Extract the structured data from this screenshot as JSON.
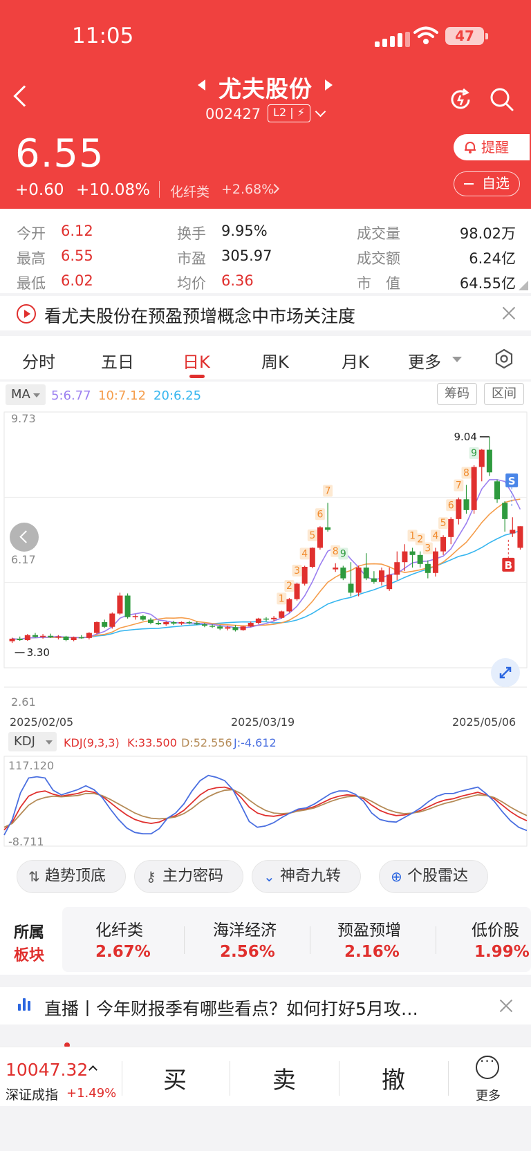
{
  "status_bar": {
    "time": "11:05",
    "battery": "47"
  },
  "header": {
    "stock_name": "尤夫股份",
    "stock_code": "002427",
    "level_badge": "L2 | ⚡"
  },
  "quote": {
    "price": "6.55",
    "change": "+0.60",
    "change_pct": "+10.08%",
    "sector": "化纤类",
    "sector_pct": "+2.68%",
    "remind_label": "提醒",
    "watch_label": "自选"
  },
  "stats": [
    {
      "label": "今开",
      "value": "6.12"
    },
    {
      "label": "最高",
      "value": "6.55"
    },
    {
      "label": "最低",
      "value": "6.02"
    },
    {
      "label": "换手",
      "value": "9.95%"
    },
    {
      "label": "市盈",
      "value": "305.97"
    },
    {
      "label": "均价",
      "value": "6.36"
    },
    {
      "label": "成交量",
      "value": "98.02万"
    },
    {
      "label": "成交额",
      "value": "6.24亿"
    },
    {
      "label": "市　值",
      "value": "64.55亿"
    }
  ],
  "notice": {
    "text": "看尤夫股份在预盈预增概念中市场关注度"
  },
  "tabs": [
    "分时",
    "五日",
    "日K",
    "周K",
    "月K",
    "更多"
  ],
  "active_tab": "日K",
  "chart_controls": {
    "ma_selector": "MA",
    "ma5": "5:6.77",
    "ma10": "10:7.12",
    "ma20": "20:6.25",
    "chip_button": "筹码",
    "range_button": "区间"
  },
  "colors": {
    "up": "#e0302e",
    "down": "#2e9a3e",
    "ma5": "#9b7ff0",
    "ma10": "#f59d4b",
    "ma20": "#37b6ef",
    "brand": "#f0413f"
  },
  "chart_data": [
    {
      "type": "candlestick",
      "y_axis_labels": [
        "9.73",
        "6.17",
        "2.61"
      ],
      "ylim": [
        2.61,
        9.73
      ],
      "x_labels": [
        "2025/02/05",
        "2025/03/19",
        "2025/05/06"
      ],
      "max_marker": "9.04",
      "min_marker": "3.30",
      "candles": [
        [
          3.35,
          3.45,
          3.3,
          3.42
        ],
        [
          3.42,
          3.48,
          3.36,
          3.38
        ],
        [
          3.38,
          3.55,
          3.36,
          3.52
        ],
        [
          3.52,
          3.58,
          3.45,
          3.47
        ],
        [
          3.47,
          3.55,
          3.42,
          3.5
        ],
        [
          3.5,
          3.56,
          3.44,
          3.46
        ],
        [
          3.46,
          3.52,
          3.4,
          3.48
        ],
        [
          3.48,
          3.5,
          3.35,
          3.38
        ],
        [
          3.38,
          3.48,
          3.35,
          3.46
        ],
        [
          3.46,
          3.52,
          3.42,
          3.44
        ],
        [
          3.44,
          3.6,
          3.4,
          3.58
        ],
        [
          3.58,
          3.9,
          3.55,
          3.88
        ],
        [
          3.88,
          3.95,
          3.72,
          3.75
        ],
        [
          3.75,
          4.15,
          3.7,
          4.12
        ],
        [
          4.12,
          4.7,
          4.08,
          4.62
        ],
        [
          4.62,
          4.68,
          3.98,
          4.02
        ],
        [
          4.02,
          4.1,
          3.95,
          4.05
        ],
        [
          4.05,
          4.08,
          3.92,
          3.95
        ],
        [
          3.95,
          4.0,
          3.82,
          3.86
        ],
        [
          3.86,
          3.92,
          3.8,
          3.82
        ],
        [
          3.82,
          3.9,
          3.78,
          3.88
        ],
        [
          3.88,
          3.92,
          3.8,
          3.84
        ],
        [
          3.84,
          3.9,
          3.8,
          3.88
        ],
        [
          3.88,
          3.92,
          3.82,
          3.85
        ],
        [
          3.85,
          3.9,
          3.8,
          3.82
        ],
        [
          3.82,
          3.86,
          3.74,
          3.78
        ],
        [
          3.78,
          3.82,
          3.72,
          3.76
        ],
        [
          3.76,
          3.8,
          3.66,
          3.7
        ],
        [
          3.7,
          3.78,
          3.65,
          3.74
        ],
        [
          3.74,
          3.8,
          3.62,
          3.66
        ],
        [
          3.66,
          3.78,
          3.64,
          3.76
        ],
        [
          3.76,
          3.9,
          3.74,
          3.86
        ],
        [
          3.86,
          4.0,
          3.82,
          3.98
        ],
        [
          3.98,
          4.02,
          3.9,
          3.96
        ],
        [
          3.96,
          4.05,
          3.9,
          4.0
        ],
        [
          4.0,
          4.2,
          3.98,
          4.18
        ],
        [
          4.18,
          4.55,
          4.15,
          4.52
        ],
        [
          4.52,
          4.98,
          4.48,
          4.95
        ],
        [
          4.95,
          5.45,
          4.9,
          5.42
        ],
        [
          5.42,
          5.96,
          5.38,
          5.95
        ],
        [
          5.95,
          6.55,
          5.9,
          6.52
        ],
        [
          6.52,
          7.2,
          6.4,
          6.45
        ],
        [
          5.35,
          5.52,
          5.28,
          5.4
        ],
        [
          5.4,
          5.45,
          5.05,
          5.1
        ],
        [
          4.95,
          5.55,
          4.6,
          4.7
        ],
        [
          4.7,
          5.45,
          4.6,
          5.4
        ],
        [
          5.4,
          5.8,
          5.05,
          5.1
        ],
        [
          5.1,
          5.3,
          4.95,
          5.0
        ],
        [
          5.0,
          5.4,
          4.9,
          5.32
        ],
        [
          4.8,
          5.4,
          4.75,
          5.2
        ],
        [
          5.2,
          5.85,
          5.05,
          5.55
        ],
        [
          5.55,
          6.05,
          5.3,
          5.85
        ],
        [
          5.85,
          5.95,
          5.4,
          5.75
        ],
        [
          5.75,
          5.85,
          5.4,
          5.5
        ],
        [
          5.5,
          5.6,
          5.1,
          5.25
        ],
        [
          5.25,
          5.95,
          5.15,
          5.85
        ],
        [
          5.85,
          6.3,
          5.75,
          6.25
        ],
        [
          6.25,
          6.8,
          6.05,
          6.75
        ],
        [
          6.75,
          7.35,
          6.6,
          7.3
        ],
        [
          7.3,
          7.7,
          6.9,
          7.0
        ],
        [
          7.0,
          8.25,
          6.9,
          8.2
        ],
        [
          8.2,
          8.7,
          7.8,
          8.68
        ],
        [
          8.68,
          9.04,
          7.95,
          8.05
        ],
        [
          7.8,
          7.85,
          7.2,
          7.3
        ],
        [
          7.2,
          7.25,
          6.4,
          6.75
        ],
        [
          6.35,
          6.8,
          6.25,
          6.45
        ],
        [
          5.95,
          6.55,
          5.9,
          6.55
        ]
      ],
      "signals": [
        {
          "label": "1",
          "candle": 35
        },
        {
          "label": "2",
          "candle": 36
        },
        {
          "label": "3",
          "candle": 37
        },
        {
          "label": "4",
          "candle": 38
        },
        {
          "label": "5",
          "candle": 39
        },
        {
          "label": "6",
          "candle": 40
        },
        {
          "label": "7",
          "candle": 41
        },
        {
          "label": "8",
          "candle": 42
        },
        {
          "label": "9",
          "candle": 43
        },
        {
          "label": "1",
          "candle": 52
        },
        {
          "label": "2",
          "candle": 53
        },
        {
          "label": "3",
          "candle": 54
        },
        {
          "label": "4",
          "candle": 55
        },
        {
          "label": "5",
          "candle": 56
        },
        {
          "label": "6",
          "candle": 57
        },
        {
          "label": "7",
          "candle": 58
        },
        {
          "label": "8",
          "candle": 59
        },
        {
          "label": "9",
          "candle": 60
        }
      ],
      "buy_label": "B",
      "sell_label": "S"
    },
    {
      "type": "line",
      "indicator_selector": "KDJ",
      "params": "KDJ(9,3,3)",
      "K": "K:33.500",
      "D": "D:52.556",
      "J": "J:-4.612",
      "y_axis_labels": [
        "117.120",
        "-8.711"
      ],
      "ylim": [
        -8.711,
        117.12
      ],
      "series": [
        {
          "name": "K",
          "values": [
            10,
            22,
            45,
            62,
            68,
            70,
            65,
            62,
            64,
            66,
            70,
            68,
            62,
            52,
            42,
            33,
            26,
            22,
            20,
            22,
            28,
            32,
            40,
            52,
            64,
            72,
            75,
            76,
            72,
            60,
            45,
            36,
            32,
            31,
            33,
            36,
            40,
            42,
            46,
            52,
            58,
            62,
            64,
            63,
            58,
            48,
            40,
            35,
            32,
            33,
            36,
            40,
            46,
            52,
            56,
            58,
            62,
            65,
            68,
            64,
            58,
            48,
            38,
            30,
            24
          ]
        },
        {
          "name": "D",
          "values": [
            14,
            20,
            34,
            48,
            56,
            60,
            62,
            61,
            62,
            63,
            66,
            66,
            63,
            57,
            50,
            43,
            36,
            31,
            28,
            27,
            28,
            30,
            35,
            43,
            53,
            61,
            67,
            71,
            72,
            66,
            56,
            47,
            40,
            36,
            35,
            36,
            39,
            41,
            44,
            49,
            54,
            58,
            61,
            62,
            60,
            54,
            47,
            41,
            37,
            35,
            36,
            38,
            42,
            47,
            51,
            54,
            58,
            61,
            64,
            63,
            60,
            53,
            45,
            38,
            32
          ]
        },
        {
          "name": "J",
          "values": [
            2,
            26,
            67,
            90,
            92,
            90,
            71,
            64,
            68,
            72,
            78,
            72,
            60,
            42,
            26,
            13,
            6,
            4,
            4,
            12,
            28,
            36,
            50,
            70,
            86,
            94,
            91,
            86,
            72,
            48,
            23,
            14,
            16,
            21,
            29,
            36,
            42,
            44,
            50,
            58,
            66,
            70,
            70,
            65,
            54,
            36,
            26,
            23,
            22,
            29,
            36,
            44,
            54,
            62,
            66,
            66,
            70,
            73,
            76,
            66,
            54,
            38,
            24,
            14,
            9
          ]
        }
      ]
    }
  ],
  "tools": [
    "趋势顶底",
    "主力密码",
    "神奇九转",
    "个股雷达"
  ],
  "boards": {
    "title_line1": "所属",
    "title_line2": "板块",
    "items": [
      {
        "name": "化纤类",
        "pct": "2.67%"
      },
      {
        "name": "海洋经济",
        "pct": "2.56%"
      },
      {
        "name": "预盈预增",
        "pct": "2.16%"
      },
      {
        "name": "低价股",
        "pct": "1.99%"
      }
    ]
  },
  "live": {
    "text": "直播丨今年财报季有哪些看点？如何打好5月攻…"
  },
  "bottom_bar": {
    "index_value": "10047.32",
    "index_name": "深证成指",
    "index_pct": "+1.49%",
    "buy": "买",
    "sell": "卖",
    "cancel": "撤",
    "more": "更多"
  }
}
